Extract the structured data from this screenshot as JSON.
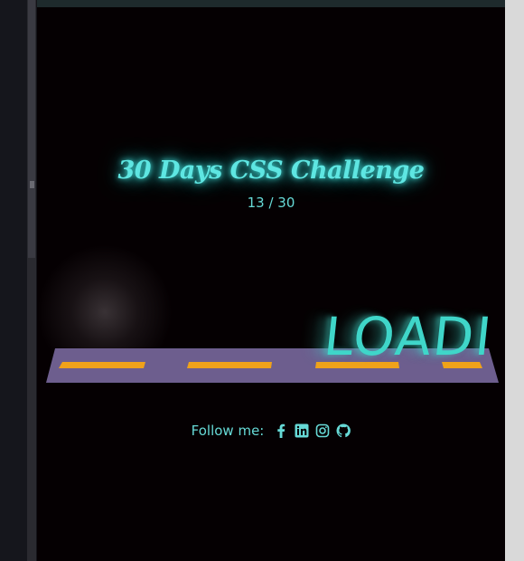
{
  "window": {
    "colors": {
      "preview_bg": "#050002",
      "neon": "#5ee6e2",
      "road": "#6d5e8e",
      "lane": "#f0a21a"
    }
  },
  "preview": {
    "title": "30 Days CSS Challenge",
    "counter": "13 / 30",
    "loading_text": "LOADI",
    "follow": {
      "label": "Follow me:",
      "icons": [
        "facebook-icon",
        "linkedin-icon",
        "instagram-icon",
        "github-icon"
      ]
    }
  }
}
